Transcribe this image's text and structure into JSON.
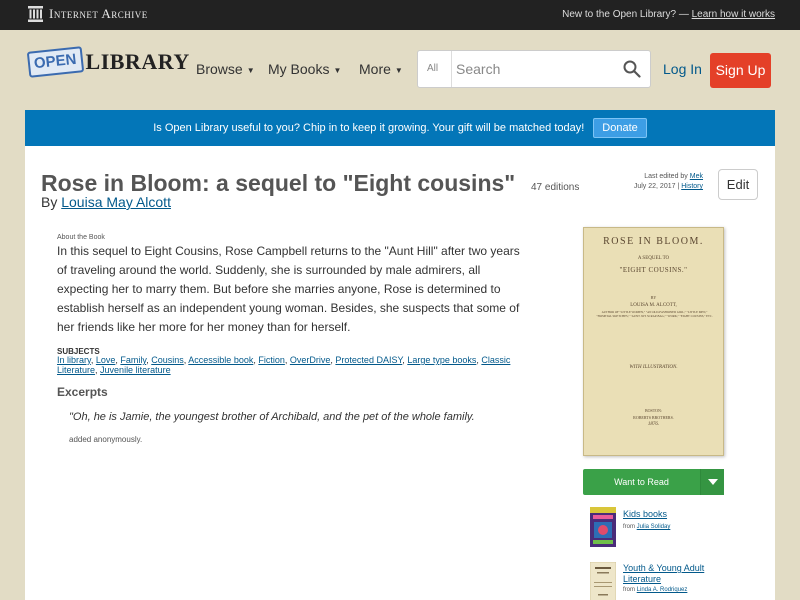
{
  "ia_bar": {
    "logo_text": "Internet Archive",
    "promo_text": "New to the Open Library? —",
    "promo_link": "Learn how it works"
  },
  "header": {
    "logo_open": "OPEN",
    "logo_library": "LIBRARY",
    "nav": [
      {
        "label": "Browse"
      },
      {
        "label": "My Books"
      },
      {
        "label": "More"
      }
    ],
    "search": {
      "scope": "All",
      "placeholder": "Search"
    },
    "login_label": "Log In",
    "signup_label": "Sign Up"
  },
  "donate_banner": {
    "text": "Is Open Library useful to you? Chip in to keep it growing. Your gift will be matched today!",
    "button_label": "Donate",
    "background": "#0376b8"
  },
  "book": {
    "title": "Rose in Bloom: a sequel to \"Eight cousins\"",
    "editions": "47 editions",
    "by": "By",
    "author": "Louisa May Alcott",
    "last_edited_prefix": "Last edited by",
    "last_edited_user": "Mek",
    "last_edited_date": "July 22, 2017 |",
    "history_label": "History",
    "edit_label": "Edit",
    "about_label": "About the Book",
    "description": "In this sequel to Eight Cousins, Rose Campbell returns to the \"Aunt Hill\" after two years of traveling around the world. Suddenly, she is surrounded by male admirers, all expecting her to marry them. But before she marries anyone, Rose is determined to establish herself as an independent young woman. Besides, she suspects that some of her friends like her more for her money than for herself.",
    "subjects_label": "SUBJECTS",
    "subjects": [
      "In library",
      "Love",
      "Family",
      "Cousins",
      "Accessible book",
      "Fiction",
      "OverDrive",
      "Protected DAISY",
      "Large type books",
      "Classic Literature",
      "Juvenile literature"
    ],
    "excerpts_heading": "Excerpts",
    "excerpt_text": "\"Oh, he is Jamie, the youngest brother of Archibald, and the pet of the whole family.",
    "excerpt_attrib": "added anonymously."
  },
  "cover": {
    "title": "ROSE IN BLOOM.",
    "sequel": "A SEQUEL TO",
    "eight_cousins": "\"EIGHT COUSINS.\"",
    "by": "BY",
    "author": "LOUISA M. ALCOTT,",
    "author_of": "AUTHOR OF \"LITTLE WOMEN,\" \"AN OLD-FASHIONED GIRL,\" \"LITTLE MEN,\" \"HOSPITAL SKETCHES,\" \"AUNT JO'S SCRAP-BAG,\" \"WORK,\" \"EIGHT COUSINS,\" ETC.",
    "illustration": "WITH ILLUSTRATION.",
    "city": "BOSTON:",
    "publisher": "ROBERTS BROTHERS.",
    "year": "1876."
  },
  "sidebar": {
    "want_to_read_label": "Want to Read",
    "lists": [
      {
        "title": "Kids books",
        "from_label": "from",
        "author": "Julia Soliday"
      },
      {
        "title": "Youth & Young Adult Literature",
        "from_label": "from",
        "author": "Linda A. Rodriquez"
      }
    ]
  },
  "colors": {
    "page_bg": "#e2dcc5",
    "accent_blue": "#0376b8",
    "signup_red": "#e44028",
    "want_to_read_green": "#3aa148"
  }
}
